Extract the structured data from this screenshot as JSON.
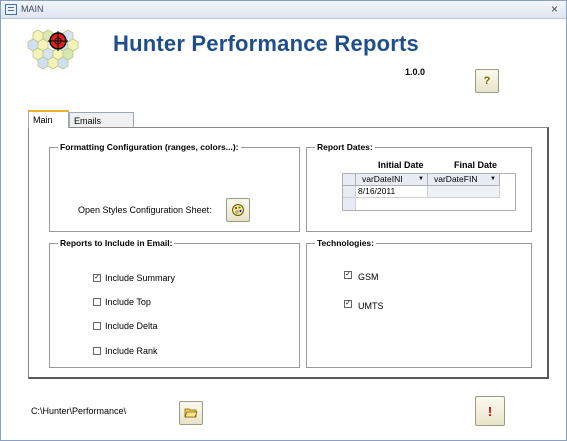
{
  "window": {
    "title": "MAIN",
    "close_symbol": "×"
  },
  "header": {
    "app_title": "Hunter Performance Reports",
    "version": "1.0.0"
  },
  "buttons": {
    "help_symbol": "?",
    "alert_symbol": "!"
  },
  "tabs": [
    {
      "label": "Main"
    },
    {
      "label": "Emails"
    }
  ],
  "formatting": {
    "title": "Formatting Configuration (ranges, colors...):",
    "open_styles_label": "Open Styles Configuration Sheet:"
  },
  "report_dates": {
    "title": "Report Dates:",
    "initial_label": "Initial Date",
    "final_label": "Final Date",
    "columns": [
      "varDateINI",
      "varDateFIN"
    ],
    "rows": [
      [
        "8/16/2011",
        ""
      ]
    ]
  },
  "reports": {
    "title": "Reports to Include in Email:",
    "items": [
      {
        "label": "Include Summary",
        "checked": "✓"
      },
      {
        "label": "Include Top",
        "checked": ""
      },
      {
        "label": "Include Delta",
        "checked": ""
      },
      {
        "label": "Include Rank",
        "checked": ""
      }
    ]
  },
  "technologies": {
    "title": "Technologies:",
    "items": [
      {
        "label": "GSM",
        "checked": "✓"
      },
      {
        "label": "UMTS",
        "checked": "✓"
      }
    ]
  },
  "footer": {
    "path": "C:\\Hunter\\Performance\\"
  },
  "icons": {
    "logo": "hexagon-target-logo",
    "help": "question-icon",
    "styles": "palette-icon",
    "folder": "folder-open-icon",
    "alert": "exclamation-icon"
  }
}
